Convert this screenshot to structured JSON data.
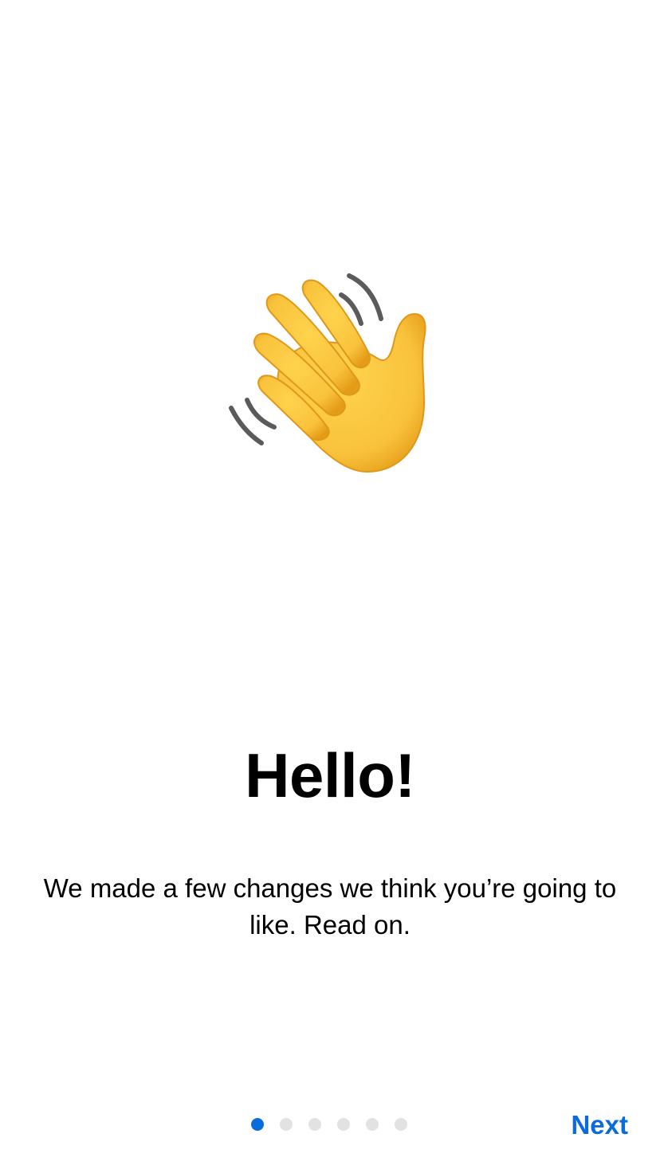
{
  "onboarding": {
    "hero_icon": "waving-hand-icon",
    "title": "Hello!",
    "body": "We made a few changes we think you’re going to like. Read on.",
    "pager": {
      "total_pages": 6,
      "current_page": 1
    },
    "next_label": "Next"
  },
  "colors": {
    "accent": "#0a6cdc",
    "dot_inactive": "#e2e2e2",
    "hand_fill": "#f9c23c",
    "hand_shadow": "#e8a317",
    "motion_lines": "#5b5b5b"
  }
}
